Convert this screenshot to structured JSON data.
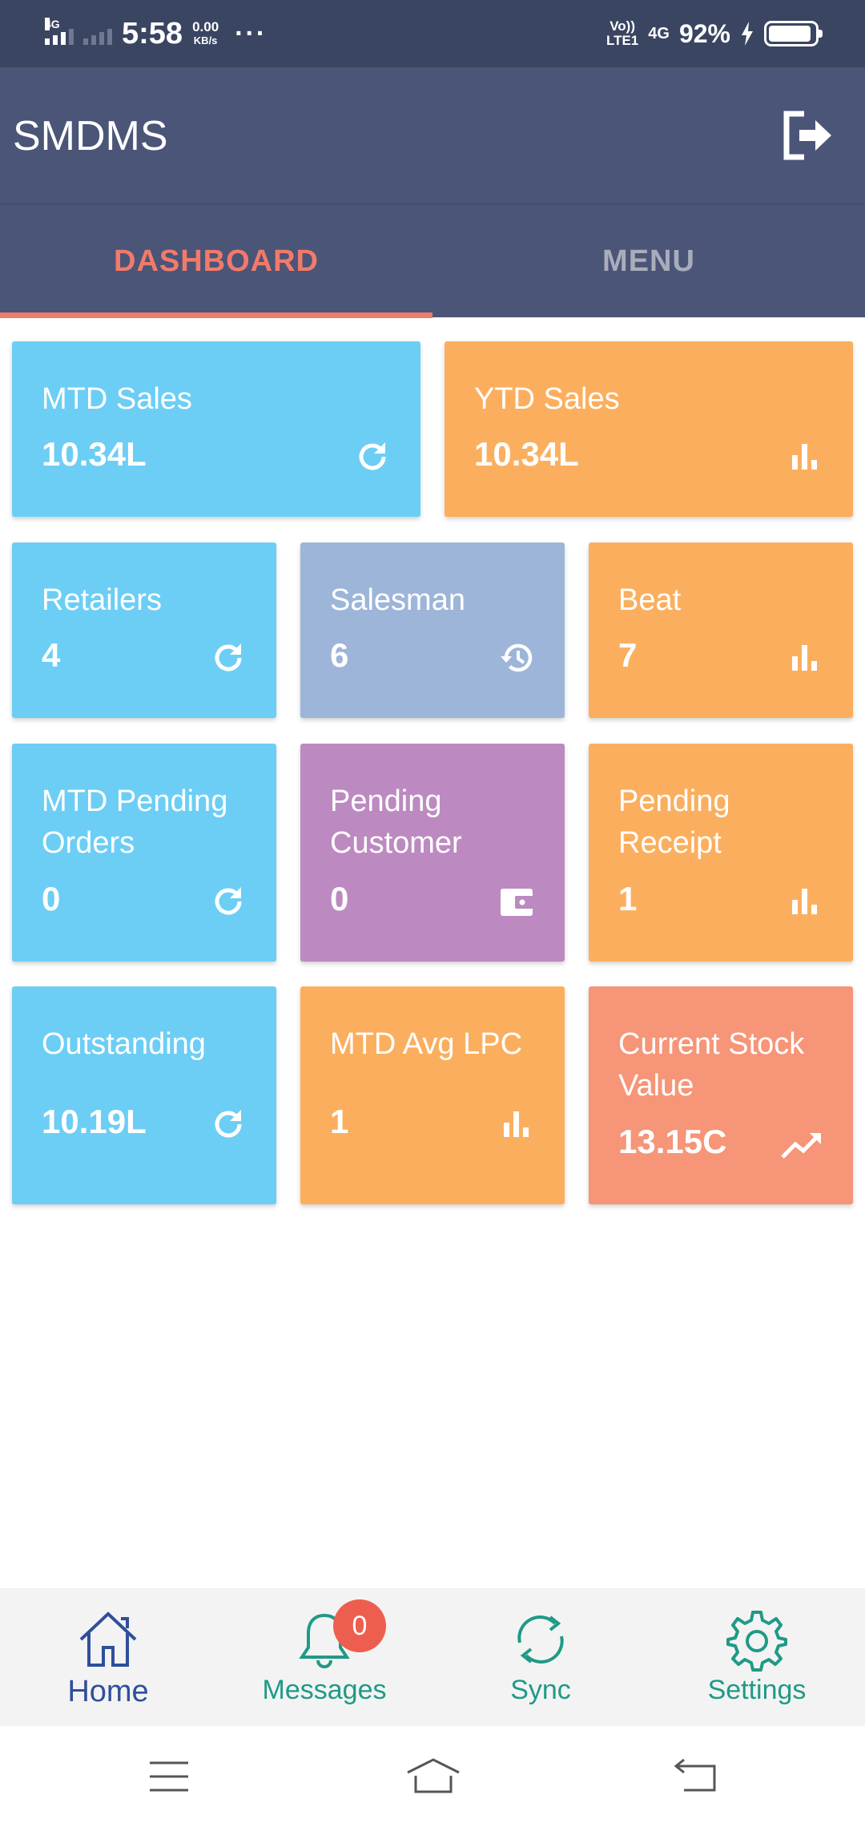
{
  "status_bar": {
    "network_tag": "4G",
    "time": "5:58",
    "speed_value": "0.00",
    "speed_unit": "KB/s",
    "more": "···",
    "volte": "Vo))",
    "lte": "LTE1",
    "network_right": "4G",
    "battery": "92%"
  },
  "app": {
    "title": "SMDMS",
    "logout_icon": "logout-icon"
  },
  "tabs": [
    {
      "label": "DASHBOARD",
      "active": true
    },
    {
      "label": "MENU",
      "active": false
    }
  ],
  "tiles": {
    "mtd_sales": {
      "label": "MTD Sales",
      "value": "10.34L",
      "icon": "refresh-icon",
      "color": "#6ccef5"
    },
    "ytd_sales": {
      "label": "YTD Sales",
      "value": "10.34L",
      "icon": "bar-chart-icon",
      "color": "#fbaf5e"
    },
    "retailers": {
      "label": "Retailers",
      "value": "4",
      "icon": "refresh-icon",
      "color": "#6ccef5"
    },
    "salesman": {
      "label": "Salesman",
      "value": "6",
      "icon": "history-icon",
      "color": "#9db5d8"
    },
    "beat": {
      "label": "Beat",
      "value": "7",
      "icon": "bar-chart-icon",
      "color": "#fbaf5e"
    },
    "mtd_pending_orders": {
      "label_line1": "MTD Pending",
      "label_line2": "Orders",
      "value": "0",
      "icon": "refresh-icon",
      "color": "#6ccef5"
    },
    "pending_customer": {
      "label_line1": "Pending",
      "label_line2": "Customer",
      "value": "0",
      "icon": "wallet-icon",
      "color": "#bc8ac0"
    },
    "pending_receipt": {
      "label_line1": "Pending",
      "label_line2": "Receipt",
      "value": "1",
      "icon": "bar-chart-icon",
      "color": "#fbaf5e"
    },
    "outstanding": {
      "label": "Outstanding",
      "value": "10.19L",
      "icon": "refresh-icon",
      "color": "#6ccef5"
    },
    "mtd_avg_lpc": {
      "label": "MTD Avg LPC",
      "value": "1",
      "icon": "bar-chart-icon",
      "color": "#fbaf5e"
    },
    "current_stock_value": {
      "label_line1": "Current Stock",
      "label_line2": "Value",
      "value": "13.15C",
      "icon": "trending-up-icon",
      "color": "#f69577"
    }
  },
  "bottom_nav": [
    {
      "label": "Home",
      "icon": "home-icon",
      "color": "#2f4f9a"
    },
    {
      "label": "Messages",
      "icon": "bell-icon",
      "badge": "0",
      "color": "#1f9a86"
    },
    {
      "label": "Sync",
      "icon": "sync-icon",
      "color": "#1f9a86"
    },
    {
      "label": "Settings",
      "icon": "gear-icon",
      "color": "#1f9a86"
    }
  ],
  "system_nav": [
    "menu-icon",
    "home-outline-icon",
    "back-icon"
  ]
}
